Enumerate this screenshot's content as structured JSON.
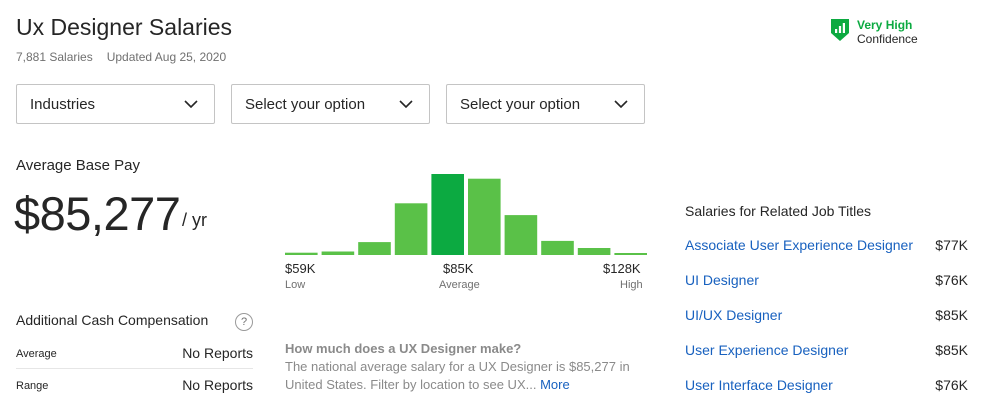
{
  "header": {
    "title": "Ux Designer Salaries",
    "salary_count": "7,881 Salaries",
    "updated": "Updated Aug 25, 2020"
  },
  "confidence": {
    "level": "Very High",
    "label": "Confidence",
    "icon": "shield-bar-chart-icon",
    "color": "#0caa41"
  },
  "filters": [
    {
      "value": "Industries"
    },
    {
      "value": "Select your option"
    },
    {
      "value": "Select your option"
    }
  ],
  "average_pay": {
    "label": "Average Base Pay",
    "value": "$85,277",
    "period": "/ yr"
  },
  "histogram": {
    "bars": [
      2,
      3,
      11,
      44,
      69,
      65,
      34,
      12,
      6,
      1
    ],
    "highlight_index": 4,
    "max": 69,
    "bar_color": "#5ac148",
    "highlight_color": "#0caa41",
    "low": {
      "value": "$59K",
      "label": "Low"
    },
    "mid": {
      "value": "$85K",
      "label": "Average"
    },
    "high": {
      "value": "$128K",
      "label": "High"
    }
  },
  "cash_compensation": {
    "title": "Additional Cash Compensation",
    "help": "?",
    "rows": [
      {
        "label": "Average",
        "value": "No Reports"
      },
      {
        "label": "Range",
        "value": "No Reports"
      }
    ]
  },
  "faq": {
    "question": "How much does a UX Designer make?",
    "answer": "The national average salary for a UX Designer is $85,277 in United States. Filter by location to see UX...",
    "more": "More"
  },
  "related": {
    "title": "Salaries for Related Job Titles",
    "items": [
      {
        "title": "Associate User Experience Designer",
        "salary": "$77K"
      },
      {
        "title": "UI Designer",
        "salary": "$76K"
      },
      {
        "title": "UI/UX Designer",
        "salary": "$85K"
      },
      {
        "title": "User Experience Designer",
        "salary": "$85K"
      },
      {
        "title": "User Interface Designer",
        "salary": "$76K"
      }
    ]
  }
}
